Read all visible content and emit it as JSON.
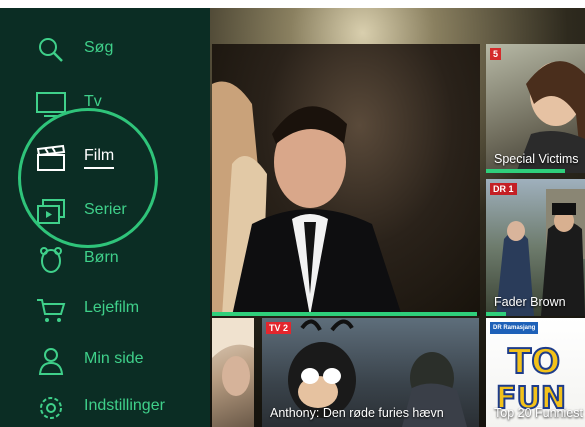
{
  "sidebar": {
    "items": [
      {
        "label": "Søg",
        "icon": "search-icon"
      },
      {
        "label": "Tv",
        "icon": "tv-icon"
      },
      {
        "label": "Film",
        "icon": "clapperboard-icon",
        "active": true
      },
      {
        "label": "Serier",
        "icon": "series-icon"
      },
      {
        "label": "Børn",
        "icon": "kids-icon"
      },
      {
        "label": "Lejefilm",
        "icon": "cart-icon"
      },
      {
        "label": "Min side",
        "icon": "person-icon"
      },
      {
        "label": "Indstillinger",
        "icon": "gear-icon"
      }
    ]
  },
  "tiles": {
    "featured": {
      "caption": "",
      "progress": 0.99
    },
    "special_victims": {
      "channel": "5",
      "caption": "Special Victims",
      "progress": 0.8
    },
    "fader_brown": {
      "channel": "DR 1",
      "caption": "Fader Brown",
      "progress": 0.2
    },
    "anthony": {
      "channel": "TV 2",
      "caption": "Anthony: Den røde furies hævn"
    },
    "top20": {
      "channel": "DR Ramasjang",
      "caption": "Top 20 Funniest"
    }
  },
  "colors": {
    "sidebar": "#0b2d24",
    "accent": "#2fc47a",
    "label": "#3fd08a"
  }
}
